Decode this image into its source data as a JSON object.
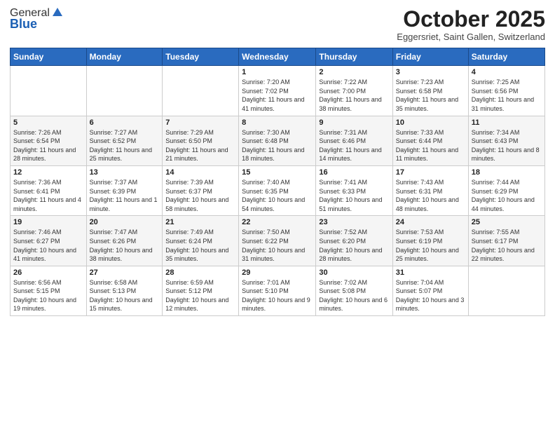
{
  "header": {
    "logo_general": "General",
    "logo_blue": "Blue",
    "month_title": "October 2025",
    "location": "Eggersriet, Saint Gallen, Switzerland"
  },
  "weekdays": [
    "Sunday",
    "Monday",
    "Tuesday",
    "Wednesday",
    "Thursday",
    "Friday",
    "Saturday"
  ],
  "weeks": [
    [
      {
        "day": "",
        "sunrise": "",
        "sunset": "",
        "daylight": ""
      },
      {
        "day": "",
        "sunrise": "",
        "sunset": "",
        "daylight": ""
      },
      {
        "day": "",
        "sunrise": "",
        "sunset": "",
        "daylight": ""
      },
      {
        "day": "1",
        "sunrise": "Sunrise: 7:20 AM",
        "sunset": "Sunset: 7:02 PM",
        "daylight": "Daylight: 11 hours and 41 minutes."
      },
      {
        "day": "2",
        "sunrise": "Sunrise: 7:22 AM",
        "sunset": "Sunset: 7:00 PM",
        "daylight": "Daylight: 11 hours and 38 minutes."
      },
      {
        "day": "3",
        "sunrise": "Sunrise: 7:23 AM",
        "sunset": "Sunset: 6:58 PM",
        "daylight": "Daylight: 11 hours and 35 minutes."
      },
      {
        "day": "4",
        "sunrise": "Sunrise: 7:25 AM",
        "sunset": "Sunset: 6:56 PM",
        "daylight": "Daylight: 11 hours and 31 minutes."
      }
    ],
    [
      {
        "day": "5",
        "sunrise": "Sunrise: 7:26 AM",
        "sunset": "Sunset: 6:54 PM",
        "daylight": "Daylight: 11 hours and 28 minutes."
      },
      {
        "day": "6",
        "sunrise": "Sunrise: 7:27 AM",
        "sunset": "Sunset: 6:52 PM",
        "daylight": "Daylight: 11 hours and 25 minutes."
      },
      {
        "day": "7",
        "sunrise": "Sunrise: 7:29 AM",
        "sunset": "Sunset: 6:50 PM",
        "daylight": "Daylight: 11 hours and 21 minutes."
      },
      {
        "day": "8",
        "sunrise": "Sunrise: 7:30 AM",
        "sunset": "Sunset: 6:48 PM",
        "daylight": "Daylight: 11 hours and 18 minutes."
      },
      {
        "day": "9",
        "sunrise": "Sunrise: 7:31 AM",
        "sunset": "Sunset: 6:46 PM",
        "daylight": "Daylight: 11 hours and 14 minutes."
      },
      {
        "day": "10",
        "sunrise": "Sunrise: 7:33 AM",
        "sunset": "Sunset: 6:44 PM",
        "daylight": "Daylight: 11 hours and 11 minutes."
      },
      {
        "day": "11",
        "sunrise": "Sunrise: 7:34 AM",
        "sunset": "Sunset: 6:43 PM",
        "daylight": "Daylight: 11 hours and 8 minutes."
      }
    ],
    [
      {
        "day": "12",
        "sunrise": "Sunrise: 7:36 AM",
        "sunset": "Sunset: 6:41 PM",
        "daylight": "Daylight: 11 hours and 4 minutes."
      },
      {
        "day": "13",
        "sunrise": "Sunrise: 7:37 AM",
        "sunset": "Sunset: 6:39 PM",
        "daylight": "Daylight: 11 hours and 1 minute."
      },
      {
        "day": "14",
        "sunrise": "Sunrise: 7:39 AM",
        "sunset": "Sunset: 6:37 PM",
        "daylight": "Daylight: 10 hours and 58 minutes."
      },
      {
        "day": "15",
        "sunrise": "Sunrise: 7:40 AM",
        "sunset": "Sunset: 6:35 PM",
        "daylight": "Daylight: 10 hours and 54 minutes."
      },
      {
        "day": "16",
        "sunrise": "Sunrise: 7:41 AM",
        "sunset": "Sunset: 6:33 PM",
        "daylight": "Daylight: 10 hours and 51 minutes."
      },
      {
        "day": "17",
        "sunrise": "Sunrise: 7:43 AM",
        "sunset": "Sunset: 6:31 PM",
        "daylight": "Daylight: 10 hours and 48 minutes."
      },
      {
        "day": "18",
        "sunrise": "Sunrise: 7:44 AM",
        "sunset": "Sunset: 6:29 PM",
        "daylight": "Daylight: 10 hours and 44 minutes."
      }
    ],
    [
      {
        "day": "19",
        "sunrise": "Sunrise: 7:46 AM",
        "sunset": "Sunset: 6:27 PM",
        "daylight": "Daylight: 10 hours and 41 minutes."
      },
      {
        "day": "20",
        "sunrise": "Sunrise: 7:47 AM",
        "sunset": "Sunset: 6:26 PM",
        "daylight": "Daylight: 10 hours and 38 minutes."
      },
      {
        "day": "21",
        "sunrise": "Sunrise: 7:49 AM",
        "sunset": "Sunset: 6:24 PM",
        "daylight": "Daylight: 10 hours and 35 minutes."
      },
      {
        "day": "22",
        "sunrise": "Sunrise: 7:50 AM",
        "sunset": "Sunset: 6:22 PM",
        "daylight": "Daylight: 10 hours and 31 minutes."
      },
      {
        "day": "23",
        "sunrise": "Sunrise: 7:52 AM",
        "sunset": "Sunset: 6:20 PM",
        "daylight": "Daylight: 10 hours and 28 minutes."
      },
      {
        "day": "24",
        "sunrise": "Sunrise: 7:53 AM",
        "sunset": "Sunset: 6:19 PM",
        "daylight": "Daylight: 10 hours and 25 minutes."
      },
      {
        "day": "25",
        "sunrise": "Sunrise: 7:55 AM",
        "sunset": "Sunset: 6:17 PM",
        "daylight": "Daylight: 10 hours and 22 minutes."
      }
    ],
    [
      {
        "day": "26",
        "sunrise": "Sunrise: 6:56 AM",
        "sunset": "Sunset: 5:15 PM",
        "daylight": "Daylight: 10 hours and 19 minutes."
      },
      {
        "day": "27",
        "sunrise": "Sunrise: 6:58 AM",
        "sunset": "Sunset: 5:13 PM",
        "daylight": "Daylight: 10 hours and 15 minutes."
      },
      {
        "day": "28",
        "sunrise": "Sunrise: 6:59 AM",
        "sunset": "Sunset: 5:12 PM",
        "daylight": "Daylight: 10 hours and 12 minutes."
      },
      {
        "day": "29",
        "sunrise": "Sunrise: 7:01 AM",
        "sunset": "Sunset: 5:10 PM",
        "daylight": "Daylight: 10 hours and 9 minutes."
      },
      {
        "day": "30",
        "sunrise": "Sunrise: 7:02 AM",
        "sunset": "Sunset: 5:08 PM",
        "daylight": "Daylight: 10 hours and 6 minutes."
      },
      {
        "day": "31",
        "sunrise": "Sunrise: 7:04 AM",
        "sunset": "Sunset: 5:07 PM",
        "daylight": "Daylight: 10 hours and 3 minutes."
      },
      {
        "day": "",
        "sunrise": "",
        "sunset": "",
        "daylight": ""
      }
    ]
  ]
}
